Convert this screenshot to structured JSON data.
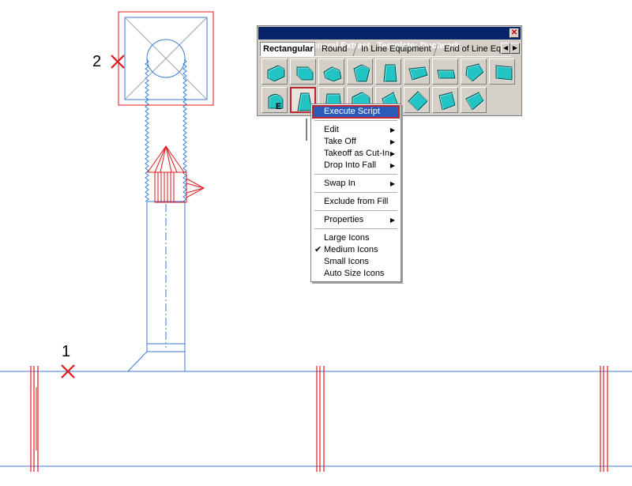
{
  "drawing": {
    "markers": [
      {
        "label": "1"
      },
      {
        "label": "2"
      }
    ]
  },
  "palette": {
    "title": "Service: General Extract   Template: Ductwork",
    "tabs": [
      "Rectangular",
      "Round",
      "In Line Equipment",
      "End of Line Equip"
    ],
    "active_tab": "Rectangular",
    "scroll_left": "◀",
    "scroll_right": "▶",
    "selected_item_badge": "E",
    "colors": {
      "duct_fill": "#22c4c4",
      "duct_stroke": "#0b4b4b",
      "selection": "#c0232f"
    }
  },
  "context_menu": {
    "items": [
      {
        "label": "Execute Script",
        "highlighted": true
      },
      {
        "separator": true
      },
      {
        "label": "Edit",
        "submenu": true
      },
      {
        "label": "Take Off",
        "submenu": true
      },
      {
        "label": "Takeoff as Cut-In",
        "submenu": true
      },
      {
        "label": "Drop Into Fall",
        "submenu": true
      },
      {
        "separator": true
      },
      {
        "label": "Swap In",
        "submenu": true
      },
      {
        "separator": true
      },
      {
        "label": "Exclude from Fill"
      },
      {
        "separator": true
      },
      {
        "label": "Properties",
        "submenu": true
      },
      {
        "separator": true
      },
      {
        "label": "Large Icons"
      },
      {
        "label": "Medium Icons",
        "checked": true
      },
      {
        "label": "Small Icons"
      },
      {
        "label": "Auto Size Icons"
      }
    ]
  }
}
